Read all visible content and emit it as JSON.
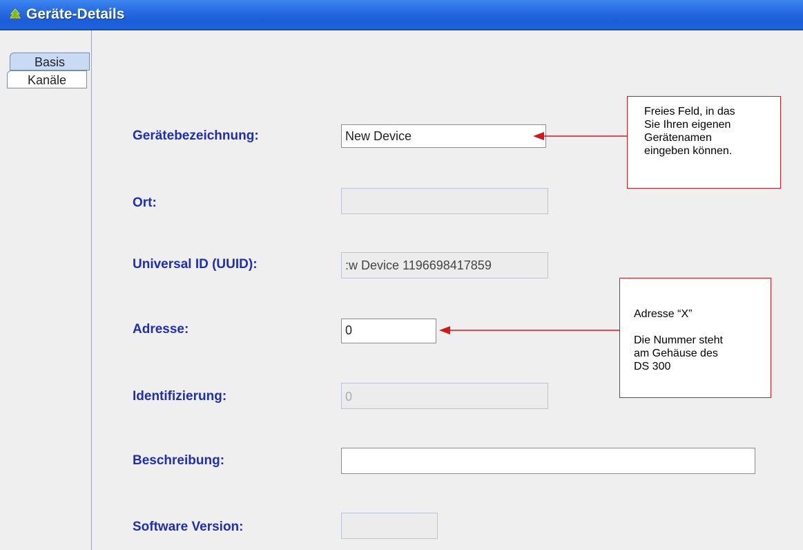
{
  "window": {
    "title": "Geräte-Details",
    "icon": "app-tree-icon"
  },
  "tabs": [
    {
      "label": "Basis",
      "selected": true
    },
    {
      "label": "Kanäle",
      "selected": false
    }
  ],
  "fields": {
    "geraetebezeichnung": {
      "label": "Gerätebezeichnung:",
      "value": "New Device",
      "enabled": true
    },
    "ort": {
      "label": "Ort:",
      "value": "",
      "enabled": false
    },
    "uuid": {
      "label": "Universal ID (UUID):",
      "value": ":w Device 1196698417859",
      "enabled": false
    },
    "adresse": {
      "label": "Adresse:",
      "value": "0",
      "enabled": true
    },
    "identifizierung": {
      "label": "Identifizierung:",
      "value": "0",
      "enabled": false
    },
    "beschreibung": {
      "label": "Beschreibung:",
      "value": "",
      "enabled": true
    },
    "software_version": {
      "label": "Software Version:",
      "value": "",
      "enabled": false
    }
  },
  "annotations": {
    "name_note": [
      "Freies Feld, in das",
      "Sie Ihren eigenen",
      "Gerätenamen",
      "eingeben können."
    ],
    "address_note": {
      "line1": "Adresse “X”",
      "lines": [
        "Die Nummer steht",
        "am Gehäuse des",
        "DS 300"
      ]
    }
  },
  "colors": {
    "titlebar": "#2a6ee4",
    "label": "#1f2fb0",
    "annotation": "#d21a1a"
  }
}
